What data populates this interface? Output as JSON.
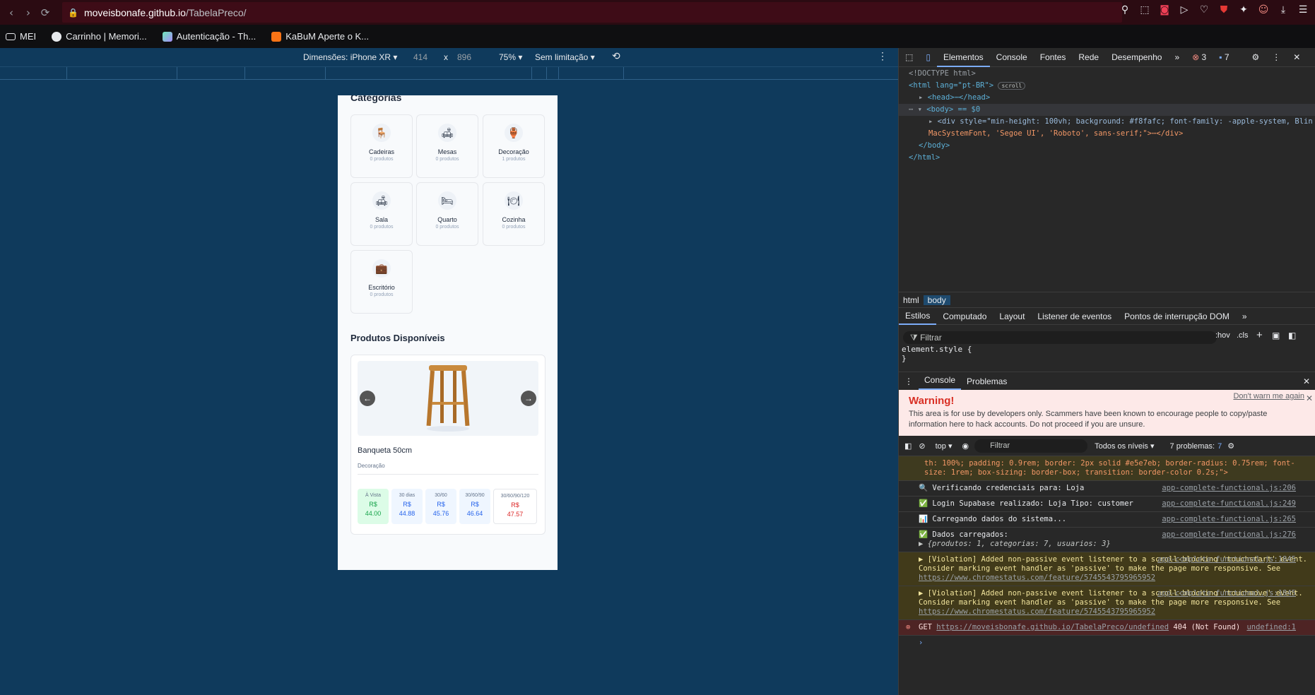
{
  "browser": {
    "url_domain": "moveisbonafe.github.io",
    "url_path": "/TabelaPreco/",
    "bookmarks": [
      "MEI",
      "Carrinho | Memori...",
      "Autenticação - Th...",
      "KaBuM Aperte o K..."
    ]
  },
  "device_toolbar": {
    "device_label": "Dimensões: iPhone XR ▾",
    "width": "414",
    "times": "x",
    "height": "896",
    "zoom": "75% ▾",
    "throttle": "Sem limitação ▾"
  },
  "app": {
    "categories_title": "Categorias",
    "categories": [
      {
        "name": "Cadeiras",
        "count": "0 produtos",
        "icon": "🪑"
      },
      {
        "name": "Mesas",
        "count": "0 produtos",
        "icon": "🛋"
      },
      {
        "name": "Decoração",
        "count": "1 produtos",
        "icon": "🏺"
      },
      {
        "name": "Sala",
        "count": "0 produtos",
        "icon": "🛋"
      },
      {
        "name": "Quarto",
        "count": "0 produtos",
        "icon": "🛏"
      },
      {
        "name": "Cozinha",
        "count": "0 produtos",
        "icon": "🍽"
      },
      {
        "name": "Escritório",
        "count": "0 produtos",
        "icon": "💼"
      }
    ],
    "products_title": "Produtos Disponíveis",
    "product": {
      "name": "Banqueta 50cm",
      "category": "Decoração",
      "prev": "←",
      "next": "→",
      "prices": [
        {
          "label": "À Vista",
          "currency": "R$",
          "value": "44.00",
          "bg": "#dcfce7",
          "color": "#16a34a"
        },
        {
          "label": "30 dias",
          "currency": "R$",
          "value": "44.88",
          "bg": "#eff6ff",
          "color": "#2563eb"
        },
        {
          "label": "30/60",
          "currency": "R$",
          "value": "45.76",
          "bg": "#eff6ff",
          "color": "#2563eb"
        },
        {
          "label": "30/60/90",
          "currency": "R$",
          "value": "46.64",
          "bg": "#eff6ff",
          "color": "#2563eb"
        },
        {
          "label": "30/60/90/120",
          "currency": "R$",
          "value": "47.57",
          "bg": "#ffffff",
          "color": "#dc2626"
        }
      ]
    }
  },
  "devtools": {
    "tabs": [
      "Elementos",
      "Console",
      "Fontes",
      "Rede",
      "Desempenho",
      "»"
    ],
    "errors": "3",
    "messages": "7",
    "dom": {
      "doctype": "<!DOCTYPE html>",
      "html_open": "<html lang=\"pt-BR\">",
      "scroll_badge": "scroll",
      "head": "<head>⋯</head>",
      "body_open": "<body> == $0",
      "div_line1": "<div style=\"min-height: 100vh; background: #f8fafc; font-family: -apple-system, Blin",
      "div_line2": "MacSystemFont, 'Segoe UI', 'Roboto', sans-serif;\">⋯</div>",
      "body_close": "</body>",
      "html_close": "</html>"
    },
    "breadcrumbs": [
      "html",
      "body"
    ],
    "style_tabs": [
      "Estilos",
      "Computado",
      "Layout",
      "Listener de eventos",
      "Pontos de interrupção DOM",
      "»"
    ],
    "filter_placeholder": "Filtrar",
    "hov": ":hov",
    "cls": ".cls",
    "element_style": "element.style {",
    "element_style_close": "}",
    "drawer_tabs": [
      "Console",
      "Problemas"
    ],
    "warning": {
      "title": "Warning!",
      "dont_warn": "Don't warn me again",
      "body": "This area is for use by developers only. Scammers have been known to encourage people to copy/paste information here to hack accounts. Do not proceed if you are unsure."
    },
    "console_tools": {
      "context": "top ▾",
      "filter": "Filtrar",
      "levels": "Todos os níveis ▾",
      "problems": "7 problemas:",
      "problems_count": "7"
    },
    "console": {
      "css_line": "th: 100%; padding: 0.9rem; border: 2px solid #e5e7eb; border-radius: 0.75rem; font-size: 1rem; box-sizing: border-box; transition: border-color 0.2s;\">",
      "logs": [
        {
          "text": "🔍 Verificando credenciais para: Loja",
          "src": "app-complete-functional.js:206"
        },
        {
          "text": "✅ Login Supabase realizado: Loja Tipo: customer",
          "src": "app-complete-functional.js:249"
        },
        {
          "text": "📊 Carregando dados do sistema...",
          "src": "app-complete-functional.js:265"
        },
        {
          "text": "✅ Dados carregados:",
          "src": "app-complete-functional.js:276"
        }
      ],
      "object_line": "▶ {produtos: 1, categorias: 7, usuarios: 3}",
      "violations": [
        {
          "text": "▶ [Violation] Added non-passive event listener to a scroll-blocking 'touchstart' event. Consider marking event handler as 'passive' to make the page more responsive. See",
          "src": "app-complete-functional.js:1845",
          "link": "https://www.chromestatus.com/feature/5745543795965952"
        },
        {
          "text": "▶ [Violation] Added non-passive event listener to a scroll-blocking 'touchmove' event. Consider marking event handler as 'passive' to make the page more responsive. See",
          "src": "app-complete-functional.js:1845",
          "link": "https://www.chromestatus.com/feature/5745543795965952"
        }
      ],
      "error": {
        "method": "GET",
        "url": "https://moveisbonafe.github.io/TabelaPreco/undefined",
        "status": "404 (Not Found)",
        "src": "undefined:1"
      },
      "prompt": "›"
    }
  }
}
